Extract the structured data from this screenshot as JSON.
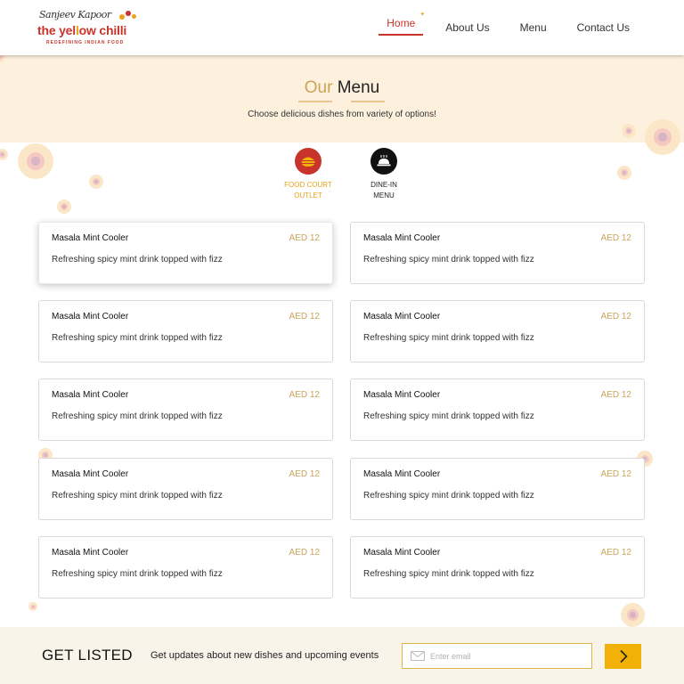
{
  "brand": {
    "signature": "Sanjeev Kapoor",
    "name_part1": "the yel",
    "name_part2": "l",
    "name_part3": "ow chilli",
    "tagline": "REDEFINING INDIAN FOOD",
    "colors": {
      "red": "#c8342b",
      "yellow": "#e8a31a"
    }
  },
  "nav": {
    "items": [
      {
        "label": "Home",
        "active": true
      },
      {
        "label": "About Us",
        "active": false
      },
      {
        "label": "Menu",
        "active": false
      },
      {
        "label": "Contact Us",
        "active": false
      }
    ]
  },
  "hero": {
    "title_accent": "Our",
    "title_main": "Menu",
    "subtitle": "Choose delicious dishes from variety of options!",
    "background": "#fdf0dd"
  },
  "categories": [
    {
      "line1": "FOOD COURT",
      "line2": "OUTLET",
      "icon": "burger-icon",
      "color": "#e8a31a",
      "circle": "#c8342b",
      "selected": true
    },
    {
      "line1": "DINE-IN",
      "line2": "MENU",
      "icon": "cloche-icon",
      "color": "#222222",
      "circle": "#111111",
      "selected": false
    }
  ],
  "menu_items": [
    {
      "name": "Masala Mint Cooler",
      "price": "AED 12",
      "description": "Refreshing spicy mint drink topped with fizz"
    },
    {
      "name": "Masala Mint Cooler",
      "price": "AED 12",
      "description": "Refreshing spicy mint drink topped with fizz"
    },
    {
      "name": "Masala Mint Cooler",
      "price": "AED 12",
      "description": "Refreshing spicy mint drink topped with fizz"
    },
    {
      "name": "Masala Mint Cooler",
      "price": "AED 12",
      "description": "Refreshing spicy mint drink topped with fizz"
    },
    {
      "name": "Masala Mint Cooler",
      "price": "AED 12",
      "description": "Refreshing spicy mint drink topped with fizz"
    },
    {
      "name": "Masala Mint Cooler",
      "price": "AED 12",
      "description": "Refreshing spicy mint drink topped with fizz"
    },
    {
      "name": "Masala Mint Cooler",
      "price": "AED 12",
      "description": "Refreshing spicy mint drink topped with fizz"
    },
    {
      "name": "Masala Mint Cooler",
      "price": "AED 12",
      "description": "Refreshing spicy mint drink topped with fizz"
    },
    {
      "name": "Masala Mint Cooler",
      "price": "AED 12",
      "description": "Refreshing spicy mint drink topped with fizz"
    },
    {
      "name": "Masala Mint Cooler",
      "price": "AED 12",
      "description": "Refreshing spicy mint drink topped with fizz"
    }
  ],
  "footer": {
    "heading": "GET LISTED",
    "message": "Get updates about new dishes and upcoming events",
    "email_placeholder": "Enter email",
    "email_value": "",
    "submit_icon": "chevron-right-icon",
    "accent": "#f2b107"
  }
}
